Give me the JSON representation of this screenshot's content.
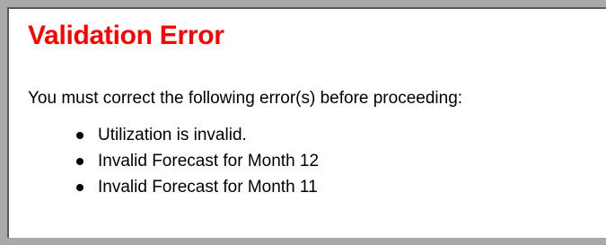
{
  "panel": {
    "title": "Validation Error",
    "title_color": "#ff0000",
    "frame_color": "#a9a9a9",
    "intro": "You must correct the following error(s) before proceeding:"
  },
  "errors": [
    {
      "text": "Utilization is invalid."
    },
    {
      "text": "Invalid Forecast for Month 12"
    },
    {
      "text": "Invalid Forecast for Month 11"
    }
  ]
}
